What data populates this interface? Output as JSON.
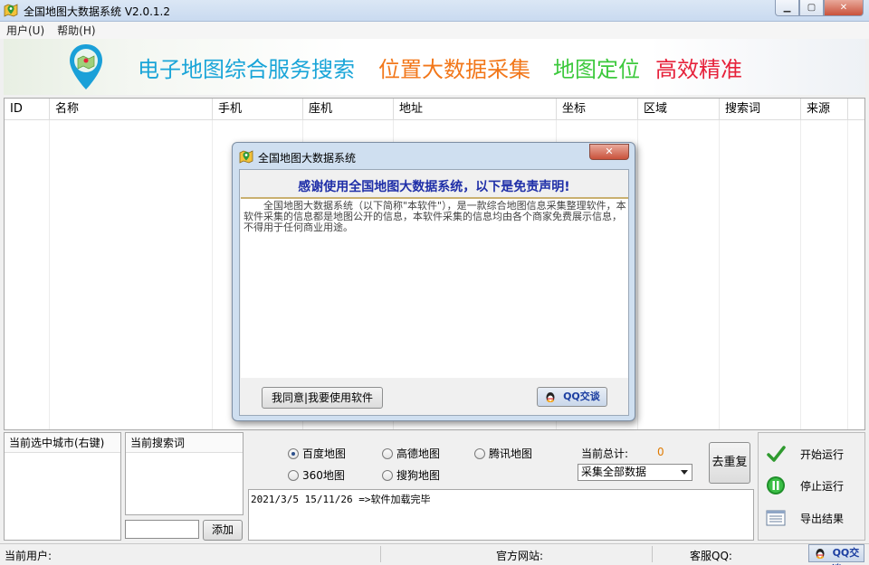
{
  "window": {
    "title": "全国地图大数据系统 V2.0.1.2",
    "min_icon": "minimize-icon",
    "max_icon": "maximize-icon",
    "close_icon": "close-icon"
  },
  "menu": {
    "items": [
      {
        "label": "用户(U)"
      },
      {
        "label": "帮助(H)"
      }
    ]
  },
  "banner": {
    "slogans": [
      "电子地图综合服务搜索",
      "位置大数据采集",
      "地图定位",
      "高效精准"
    ],
    "colors": [
      "#1aa5d8",
      "#f2771a",
      "#3dc93d",
      "#e6213a"
    ]
  },
  "table": {
    "columns": [
      "ID",
      "名称",
      "手机",
      "座机",
      "地址",
      "坐标",
      "区域",
      "搜索词",
      "来源"
    ]
  },
  "dialog": {
    "title": "全国地图大数据系统",
    "heading": "感谢使用全国地图大数据系统，以下是免责声明!",
    "body": "全国地图大数据系统（以下简称\"本软件\"），是一款综合地图信息采集整理软件，本软件采集的信息都是地图公开的信息，本软件采集的信息均由各个商家免费展示信息，不得用于任何商业用途。",
    "agree_label": "我同意|我要使用软件",
    "qq_label": "QQ交谈"
  },
  "city_panel": {
    "header": "当前选中城市(右键)"
  },
  "keyword_panel": {
    "header": "当前搜索词",
    "add_label": "添加",
    "input_value": ""
  },
  "sources": {
    "options": [
      {
        "label": "百度地图",
        "checked": true
      },
      {
        "label": "高德地图",
        "checked": false
      },
      {
        "label": "腾讯地图",
        "checked": false
      },
      {
        "label": "360地图",
        "checked": false
      },
      {
        "label": "搜狗地图",
        "checked": false
      }
    ]
  },
  "totals": {
    "label": "当前总计:",
    "value": "0"
  },
  "collect_select": {
    "value": "采集全部数据"
  },
  "reset_label": "去重复",
  "log": {
    "lines": [
      "2021/3/5 15/11/26 =>软件加载完毕"
    ]
  },
  "actions": [
    {
      "label": "开始运行",
      "icon": "check-icon"
    },
    {
      "label": "停止运行",
      "icon": "pause-icon"
    },
    {
      "label": "导出结果",
      "icon": "list-export-icon"
    }
  ],
  "statusbar": {
    "user_label": "当前用户:",
    "site_label": "官方网站:",
    "qq_label": "客服QQ:",
    "qq_button": "QQ交谈"
  }
}
